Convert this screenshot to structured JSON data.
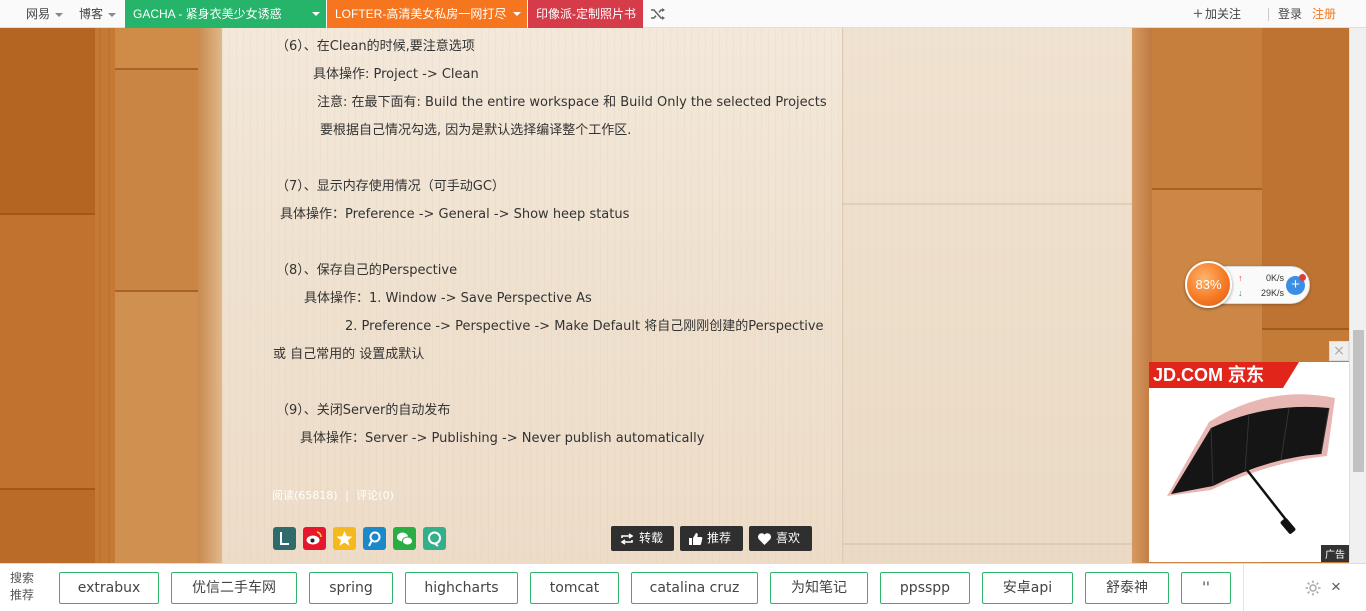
{
  "topbar": {
    "netease": "网易",
    "blog": "博客",
    "promos": [
      "GACHA - 紧身衣美少女诱惑",
      "LOFTER-高清美女私房一网打尽",
      "印像派-定制照片书"
    ],
    "follow": "加关注",
    "login": "登录",
    "register": "注册"
  },
  "article": {
    "lines": [
      "（6）、在Clean的时候,要注意选项",
      "具体操作: Project -> Clean",
      "注意: 在最下面有: Build the entire workspace 和 Build Only the selected Projects",
      "要根据自己情况勾选, 因为是默认选择编译整个工作区.",
      "（7）、显示内存使用情况（可手动GC）",
      "具体操作：Preference -> General -> Show heep status",
      "（8）、保存自己的Perspective",
      "具体操作：1. Window -> Save Perspective As",
      "2. Preference -> Perspective -> Make Default 将自己刚刚创建的Perspective",
      "或 自己常用的 设置成默认",
      "（9）、关闭Server的自动发布",
      "具体操作：Server -> Publishing -> Never publish automatically"
    ],
    "reads": "阅读(65818)",
    "separator": "|",
    "comments": "评论(0)"
  },
  "actions": {
    "repost": "转载",
    "recommend": "推荐",
    "like": "喜欢"
  },
  "share_icons": [
    "lofter-icon",
    "weibo-icon",
    "qzone-icon",
    "renren-icon",
    "wechat-icon",
    "yixin-icon"
  ],
  "net_widget": {
    "percent": "83%",
    "upload": "0K/s",
    "download": "29K/s"
  },
  "ad": {
    "brand": "JD.COM 京东",
    "tag": "广告"
  },
  "bottombar": {
    "label": "搜索推荐",
    "tags": [
      "extrabux",
      "优信二手车网",
      "spring",
      "highcharts",
      "tomcat",
      "catalina cruz",
      "为知笔记",
      "ppsspp",
      "安卓api",
      "舒泰神",
      "''"
    ]
  },
  "colors": {
    "green": "#26b46a",
    "orange": "#f5761e",
    "red": "#d63b4a",
    "tag_border": "#2fb46c",
    "jd_red": "#e1251b"
  }
}
